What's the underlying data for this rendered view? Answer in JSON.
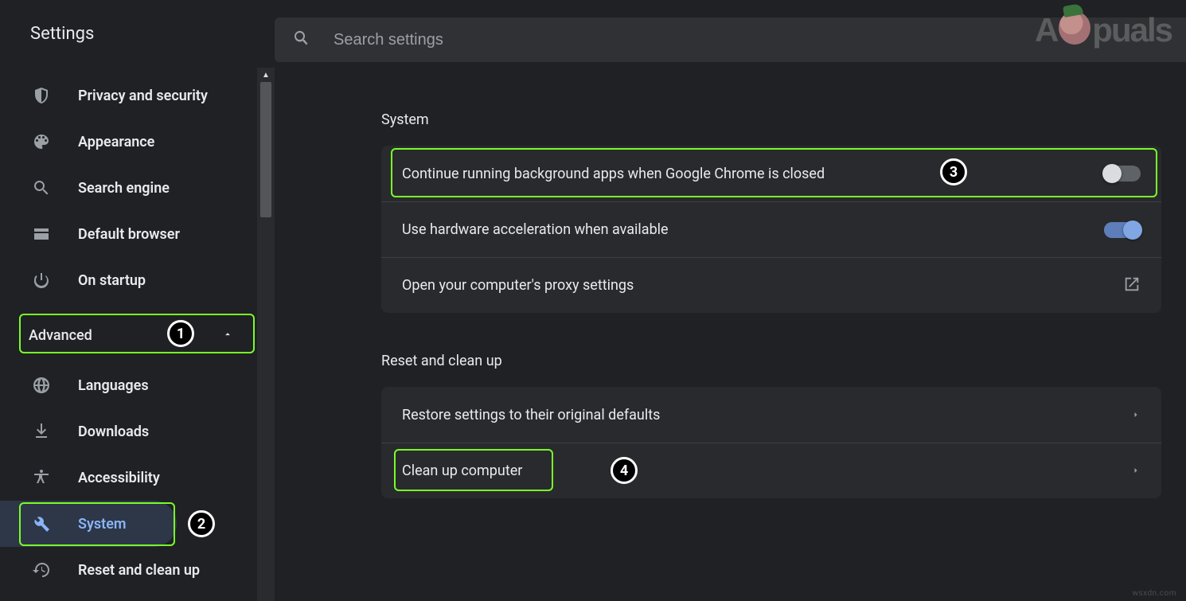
{
  "page": {
    "title": "Settings"
  },
  "search": {
    "placeholder": "Search settings"
  },
  "sidebar": {
    "items": [
      {
        "label": "Privacy and security"
      },
      {
        "label": "Appearance"
      },
      {
        "label": "Search engine"
      },
      {
        "label": "Default browser"
      },
      {
        "label": "On startup"
      }
    ],
    "advanced_label": "Advanced",
    "advanced_items": [
      {
        "label": "Languages"
      },
      {
        "label": "Downloads"
      },
      {
        "label": "Accessibility"
      },
      {
        "label": "System"
      },
      {
        "label": "Reset and clean up"
      }
    ]
  },
  "sections": {
    "system": {
      "heading": "System",
      "rows": [
        {
          "label": "Continue running background apps when Google Chrome is closed",
          "toggle": "off"
        },
        {
          "label": "Use hardware acceleration when available",
          "toggle": "on"
        },
        {
          "label": "Open your computer's proxy settings"
        }
      ]
    },
    "reset": {
      "heading": "Reset and clean up",
      "rows": [
        {
          "label": "Restore settings to their original defaults"
        },
        {
          "label": "Clean up computer"
        }
      ]
    }
  },
  "annotations": {
    "a1": "1",
    "a2": "2",
    "a3": "3",
    "a4": "4"
  },
  "watermark_left": "A",
  "watermark_right": "puals",
  "source_text": "wsxdn.com"
}
